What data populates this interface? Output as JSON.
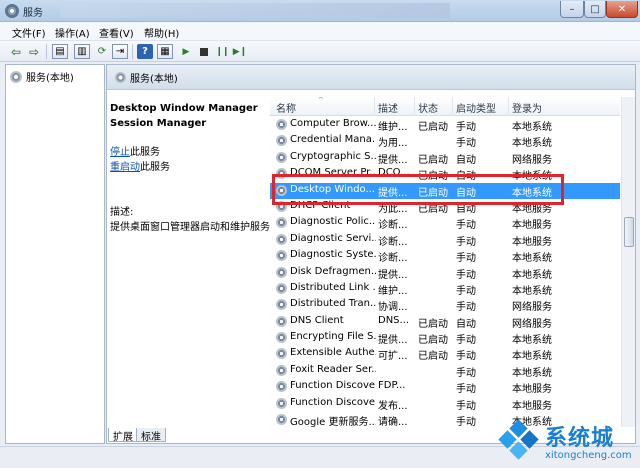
{
  "window": {
    "title": "服务",
    "min": "–",
    "max": "□",
    "close": "✕"
  },
  "menu": [
    "文件(F)",
    "操作(A)",
    "查看(V)",
    "帮助(H)"
  ],
  "toolbar": {
    "icons": [
      "back-arrow-icon",
      "forward-arrow-icon",
      "console-tree-icon",
      "export-icon",
      "refresh-icon",
      "export-list-icon",
      "help-icon",
      "properties-icon",
      "start-service-icon",
      "stop-service-icon",
      "pause-service-icon",
      "restart-service-icon"
    ]
  },
  "tree": {
    "root_label": "服务(本地)"
  },
  "content": {
    "header_label": "服务(本地)",
    "selected_service": {
      "name_line1": "Desktop Window Manager",
      "name_line2": "Session Manager"
    },
    "actions": [
      {
        "link": "停止",
        "suffix": "此服务"
      },
      {
        "link": "重启动",
        "suffix": "此服务"
      }
    ],
    "description_label": "描述:",
    "description_text": "提供桌面窗口管理器启动和维护服务"
  },
  "list": {
    "columns": [
      "名称",
      "描述",
      "状态",
      "启动类型",
      "登录为"
    ],
    "rows": [
      {
        "name": "Computer Brow...",
        "desc": "维护...",
        "state": "已启动",
        "startup": "手动",
        "logon": "本地系统",
        "selected": false
      },
      {
        "name": "Credential Mana...",
        "desc": "为用...",
        "state": "",
        "startup": "手动",
        "logon": "本地系统",
        "selected": false
      },
      {
        "name": "Cryptographic S...",
        "desc": "提供...",
        "state": "已启动",
        "startup": "自动",
        "logon": "网络服务",
        "selected": false
      },
      {
        "name": "DCOM Server Pr...",
        "desc": "DCO...",
        "state": "已启动",
        "startup": "自动",
        "logon": "本地系统",
        "selected": false
      },
      {
        "name": "Desktop Windo...",
        "desc": "提供...",
        "state": "已启动",
        "startup": "自动",
        "logon": "本地系统",
        "selected": true
      },
      {
        "name": "DHCP Client",
        "desc": "为此...",
        "state": "已启动",
        "startup": "自动",
        "logon": "本地服务",
        "selected": false
      },
      {
        "name": "Diagnostic Polic...",
        "desc": "诊断...",
        "state": "",
        "startup": "手动",
        "logon": "本地服务",
        "selected": false
      },
      {
        "name": "Diagnostic Servi...",
        "desc": "诊断...",
        "state": "",
        "startup": "手动",
        "logon": "本地服务",
        "selected": false
      },
      {
        "name": "Diagnostic Syste...",
        "desc": "诊断...",
        "state": "",
        "startup": "手动",
        "logon": "本地系统",
        "selected": false
      },
      {
        "name": "Disk Defragmen...",
        "desc": "提供...",
        "state": "",
        "startup": "手动",
        "logon": "本地系统",
        "selected": false
      },
      {
        "name": "Distributed Link ...",
        "desc": "维护...",
        "state": "",
        "startup": "手动",
        "logon": "本地系统",
        "selected": false
      },
      {
        "name": "Distributed Tran...",
        "desc": "协调...",
        "state": "",
        "startup": "手动",
        "logon": "网络服务",
        "selected": false
      },
      {
        "name": "DNS Client",
        "desc": "DNS...",
        "state": "已启动",
        "startup": "自动",
        "logon": "网络服务",
        "selected": false
      },
      {
        "name": "Encrypting File S...",
        "desc": "提供...",
        "state": "已启动",
        "startup": "手动",
        "logon": "本地系统",
        "selected": false
      },
      {
        "name": "Extensible Authe...",
        "desc": "可扩...",
        "state": "已启动",
        "startup": "手动",
        "logon": "本地系统",
        "selected": false
      },
      {
        "name": "Foxit Reader Ser...",
        "desc": "",
        "state": "",
        "startup": "手动",
        "logon": "本地系统",
        "selected": false
      },
      {
        "name": "Function Discove...",
        "desc": "FDP...",
        "state": "",
        "startup": "手动",
        "logon": "本地服务",
        "selected": false
      },
      {
        "name": "Function Discove...",
        "desc": "发布...",
        "state": "",
        "startup": "手动",
        "logon": "本地服务",
        "selected": false
      },
      {
        "name": "Google 更新服务...",
        "desc": "请确...",
        "state": "",
        "startup": "手动",
        "logon": "本地系统",
        "selected": false
      }
    ]
  },
  "tabs": [
    "扩展",
    "标准"
  ],
  "watermark": {
    "text": "系统城",
    "url": "xitongcheng.com"
  },
  "colors": {
    "selection": "#3399ff",
    "highlight_border": "#e0242c",
    "link": "#0b52b3"
  }
}
